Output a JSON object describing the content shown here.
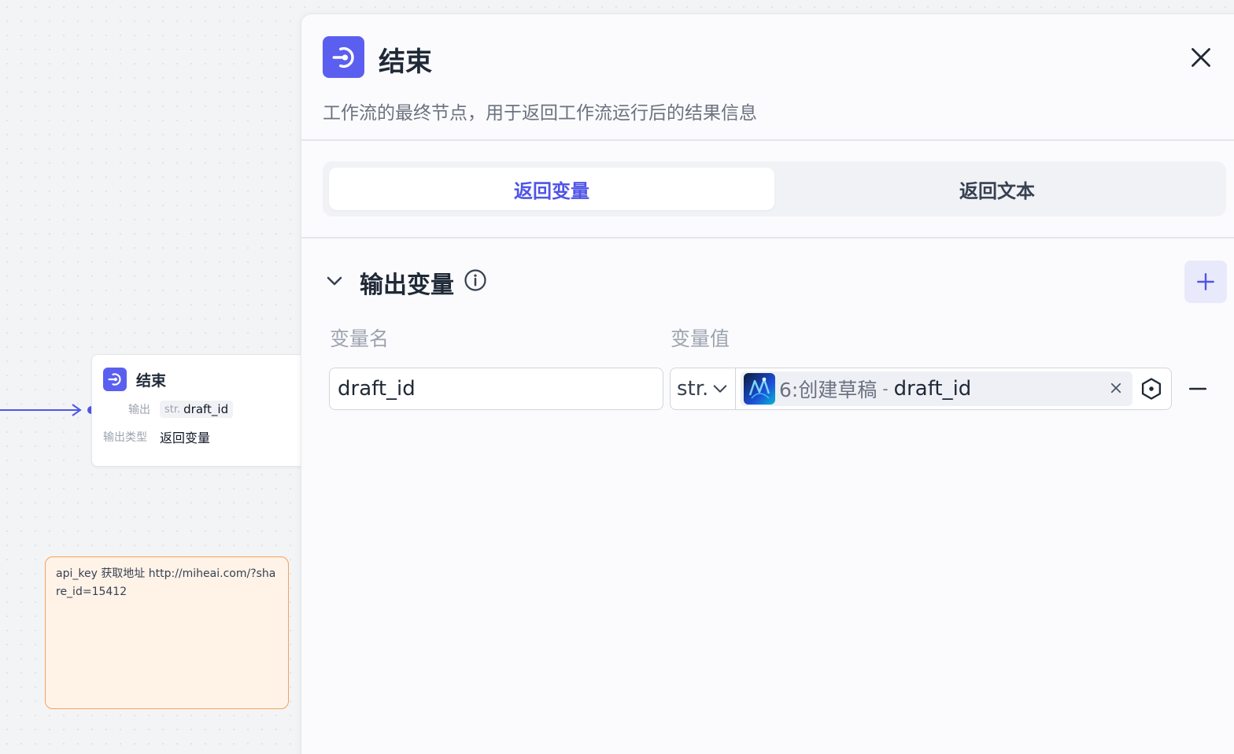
{
  "canvas": {
    "end_node": {
      "title": "结束",
      "output_label": "输出",
      "output_type": "str.",
      "output_var": "draft_id",
      "type_label": "输出类型",
      "type_value": "返回变量"
    },
    "note": {
      "text": "api_key 获取地址  http://miheai.com/?share_id=15412"
    }
  },
  "panel": {
    "title": "结束",
    "description": "工作流的最终节点，用于返回工作流运行后的结果信息",
    "tabs": [
      {
        "label": "返回变量",
        "active": true
      },
      {
        "label": "返回文本",
        "active": false
      }
    ],
    "section": {
      "title": "输出变量",
      "col_name": "变量名",
      "col_value": "变量值",
      "rows": [
        {
          "name": "draft_id",
          "type": "str.",
          "ref_node": "6:创建草稿",
          "ref_sep": "-",
          "ref_var": "draft_id"
        }
      ]
    }
  },
  "colors": {
    "accent": "#4f55e6",
    "icon_bg": "#5b5ff0",
    "note_border": "#f0a35a",
    "note_bg": "#fff3e8"
  },
  "icons": {
    "node": "end-node-icon",
    "close": "close-icon",
    "collapse": "chevron-down-icon",
    "info": "info-icon",
    "add": "plus-icon",
    "select": "chevron-down-icon",
    "clear": "close-icon",
    "variable": "hexagon-variable-icon",
    "remove": "minus-icon"
  }
}
